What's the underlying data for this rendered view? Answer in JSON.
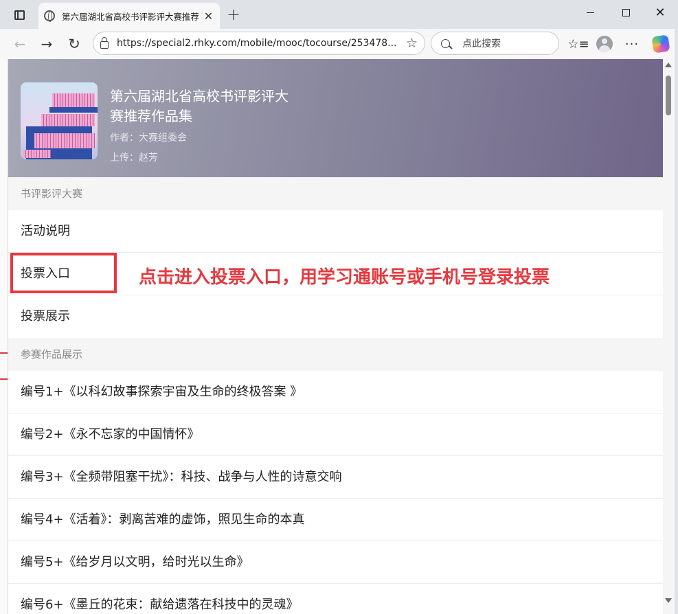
{
  "browser": {
    "tab_title": "第六届湖北省高校书评影评大赛推荐作品集",
    "tab_close": "✕",
    "new_tab": "+",
    "url": "https://special2.rhky.com/mobile/mooc/tocourse/253478...",
    "search_placeholder": "点此搜索",
    "icons": [
      "tab-actions-icon",
      "globe-icon",
      "back-icon",
      "forward-icon",
      "reload-icon",
      "lock-icon",
      "favorite-star-icon",
      "search-icon",
      "favorites-icon",
      "profile-icon",
      "more-icon",
      "copilot-icon"
    ]
  },
  "book": {
    "title": "第六届湖北省高校书评影评大赛推荐作品集",
    "author": "作者：大赛组委会",
    "uploader": "上传：赵芳"
  },
  "sections": [
    {
      "header": "书评影评大赛",
      "items": [
        "活动说明",
        "投票入口",
        "投票展示"
      ]
    },
    {
      "header": "参赛作品展示",
      "items": [
        "编号1+《以科幻故事探索宇宙及生命的终极答案 》",
        "编号2+《永不忘家的中国情怀》",
        "编号3+《全频带阻塞干扰》：科技、战争与人性的诗意交响",
        "编号4+《活着》：剥离苦难的虚饰，照见生命的本真",
        "编号5+《给岁月以文明，给时光以生命》",
        "编号6+《墨丘的花束：献给遗落在科技中的灵魂》"
      ]
    }
  ],
  "annotation": {
    "callout": "点击进入投票入口，用学习通账号或手机号登录投票",
    "color": "#e5393f"
  },
  "colors": {
    "header_start": "#a6a8b5",
    "header_end": "#6f6588",
    "accent_red": "#e5393f"
  }
}
